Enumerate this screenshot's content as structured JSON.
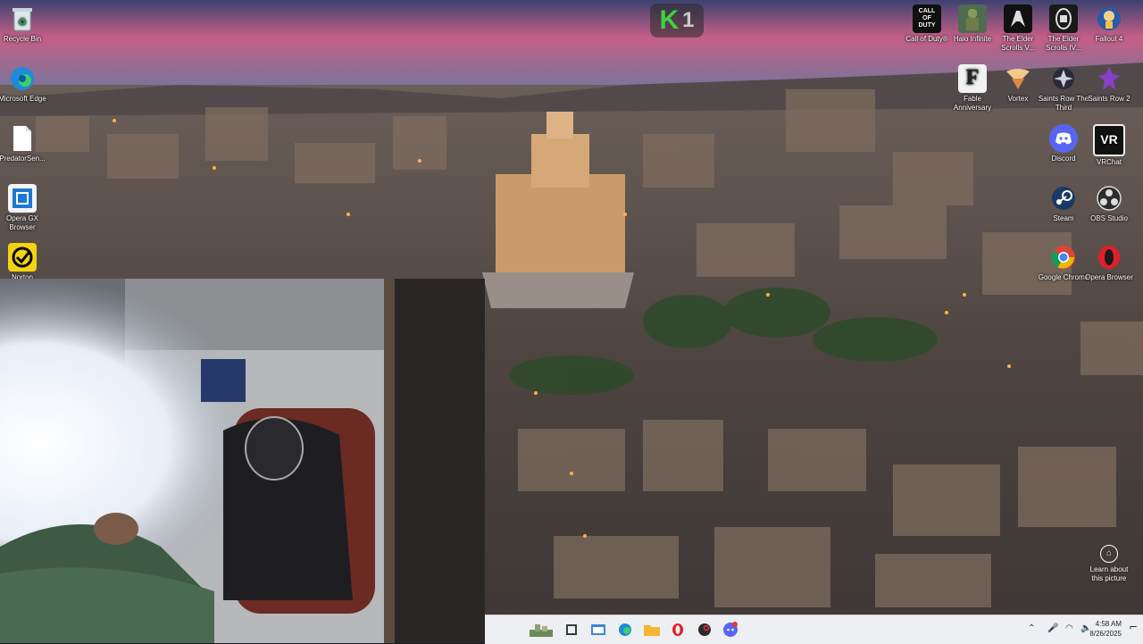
{
  "desktop_left": [
    {
      "label": "Recycle Bin",
      "icon": "recycle-bin-icon"
    },
    {
      "label": "Microsoft Edge",
      "icon": "edge-icon"
    },
    {
      "label": "PredatorSen...",
      "icon": "file-icon"
    },
    {
      "label": "Opera GX Browser",
      "icon": "opera-gx-icon"
    },
    {
      "label": "Norton",
      "icon": "norton-icon"
    }
  ],
  "desktop_right": [
    {
      "label": "Call of Duty®",
      "icon": "call-of-duty-icon",
      "glyph": "CALL OF DUTY"
    },
    {
      "label": "Halo Infinite",
      "icon": "halo-infinite-icon",
      "glyph": ""
    },
    {
      "label": "The Elder Scrolls V...",
      "icon": "elder-scrolls-v-icon",
      "glyph": ""
    },
    {
      "label": "The Elder Scrolls IV...",
      "icon": "elder-scrolls-iv-icon",
      "glyph": ""
    },
    {
      "label": "Fallout 4",
      "icon": "fallout-4-icon",
      "glyph": ""
    },
    {
      "label": "Fable Anniversary",
      "icon": "fable-anniversary-icon",
      "glyph": "F"
    },
    {
      "label": "Vortex",
      "icon": "vortex-icon",
      "glyph": ""
    },
    {
      "label": "Saints Row The Third",
      "icon": "saints-row-third-icon",
      "glyph": ""
    },
    {
      "label": "Saints Row 2",
      "icon": "saints-row-2-icon",
      "glyph": ""
    },
    {
      "label": "Discord",
      "icon": "discord-icon",
      "glyph": ""
    },
    {
      "label": "VRChat",
      "icon": "vrchat-icon",
      "glyph": "VR"
    },
    {
      "label": "Steam",
      "icon": "steam-icon",
      "glyph": ""
    },
    {
      "label": "OBS Studio",
      "icon": "obs-studio-icon",
      "glyph": ""
    },
    {
      "label": "Google Chrome",
      "icon": "google-chrome-icon",
      "glyph": ""
    },
    {
      "label": "Opera Browser",
      "icon": "opera-browser-icon",
      "glyph": ""
    }
  ],
  "overlay_badge": {
    "k": "K",
    "n": "1"
  },
  "learn_picture": {
    "label": "Learn about this picture"
  },
  "taskbar": {
    "apps": [
      "explorer-widget-icon",
      "task-view-icon",
      "store-icon",
      "edge-icon",
      "file-explorer-icon",
      "opera-icon",
      "steam-tb-icon",
      "discord-tb-icon"
    ],
    "clock_time": "4:58 AM",
    "clock_date": "8/26/2025"
  },
  "colors": {
    "sky_top": "#3a3f6a",
    "sky_pink": "#d46a8a",
    "taskbar": "#eeeff2",
    "discord": "#5865f2",
    "norton_yellow": "#f3d312"
  }
}
